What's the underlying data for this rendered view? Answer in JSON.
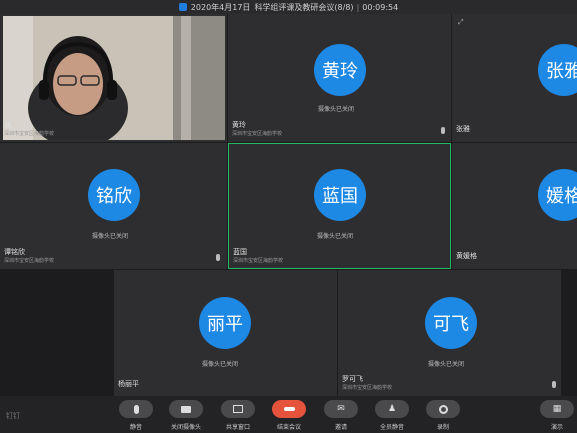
{
  "header": {
    "date": "2020年4月17日",
    "title": "科学组评课及教研会议(8/8)",
    "timer": "00:09:54"
  },
  "tiles": {
    "me": {
      "name": "我",
      "org": "深圳市宝安区海韵学校"
    },
    "huangling": {
      "avatar": "黄玲",
      "status": "摄像头已关闭",
      "name": "黄玲",
      "org": "深圳市宝安区海韵学校"
    },
    "zhangya": {
      "avatar": "张雅",
      "name": "张雅"
    },
    "mingxin": {
      "avatar": "铭欣",
      "status": "摄像头已关闭",
      "name": "谭铭欣",
      "org": "深圳市宝安区海韵学校"
    },
    "languo": {
      "avatar": "蓝国",
      "status": "摄像头已关闭",
      "name": "蓝国",
      "org": "深圳市宝安区海韵学校"
    },
    "aige": {
      "avatar": "媛格",
      "name": "黄媛格"
    },
    "liping": {
      "avatar": "丽平",
      "status": "摄像头已关闭",
      "name": "杨丽平"
    },
    "kefei": {
      "avatar": "可飞",
      "status": "摄像头已关闭",
      "name": "罗可飞",
      "org": "深圳市宝安区海韵学校"
    }
  },
  "toolbar": {
    "logo": "钉钉",
    "mute": "静音",
    "camera_off": "关闭摄像头",
    "share": "共享窗口",
    "end": "结束会议",
    "invite": "邀请",
    "mute_all": "全员静音",
    "record": "录制",
    "layout": "演示"
  },
  "colors": {
    "avatar": "#1e88e5",
    "active_border": "#25b864",
    "end_button": "#e5533d"
  }
}
